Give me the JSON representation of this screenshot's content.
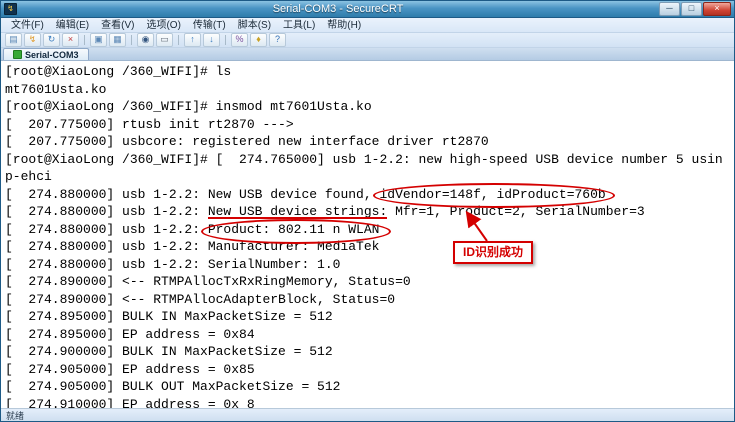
{
  "window": {
    "title": "Serial-COM3 - SecureCRT",
    "controls": {
      "minimize": "─",
      "maximize": "□",
      "close": "×"
    }
  },
  "menu": {
    "items": [
      "文件(F)",
      "编辑(E)",
      "查看(V)",
      "选项(O)",
      "传输(T)",
      "脚本(S)",
      "工具(L)",
      "帮助(H)"
    ]
  },
  "toolbar": {
    "items": [
      {
        "name": "session-manager-icon",
        "glyph": "▤",
        "color": "#5b87b5"
      },
      {
        "name": "quick-connect-icon",
        "glyph": "↯",
        "color": "#e09c2f"
      },
      {
        "name": "reconnect-icon",
        "glyph": "↻",
        "color": "#3f7fbf"
      },
      {
        "name": "disconnect-icon",
        "glyph": "×",
        "color": "#c23b3b"
      },
      {
        "name": "sep"
      },
      {
        "name": "copy-icon",
        "glyph": "▣",
        "color": "#5b87b5"
      },
      {
        "name": "paste-icon",
        "glyph": "▦",
        "color": "#5b87b5"
      },
      {
        "name": "sep"
      },
      {
        "name": "find-icon",
        "glyph": "◉",
        "color": "#33557f"
      },
      {
        "name": "print-icon",
        "glyph": "▭",
        "color": "#666f7a"
      },
      {
        "name": "sep"
      },
      {
        "name": "upload-icon",
        "glyph": "↑",
        "color": "#3f7fbf"
      },
      {
        "name": "download-icon",
        "glyph": "↓",
        "color": "#3f7fbf"
      },
      {
        "name": "sep"
      },
      {
        "name": "percent-icon",
        "glyph": "%",
        "color": "#7a4f9e"
      },
      {
        "name": "key-icon",
        "glyph": "♦",
        "color": "#c9a227"
      },
      {
        "name": "help-icon",
        "glyph": "?",
        "color": "#2f6db5"
      }
    ]
  },
  "tab": {
    "label": "Serial-COM3"
  },
  "terminal": {
    "lines": [
      "[root@XiaoLong /360_WIFI]# ls",
      "mt7601Usta.ko",
      "[root@XiaoLong /360_WIFI]# insmod mt7601Usta.ko",
      "[  207.775000] rtusb init rt2870 --->",
      "[  207.775000] usbcore: registered new interface driver rt2870",
      "[root@XiaoLong /360_WIFI]# [  274.765000] usb 1-2.2: new high-speed USB device number 5 usin",
      "p-ehci",
      "[  274.880000] usb 1-2.2: New USB device found, idVendor=148f, idProduct=760b",
      "[  274.880000] usb 1-2.2: New USB device strings: Mfr=1, Product=2, SerialNumber=3",
      "[  274.880000] usb 1-2.2: Product: 802.11 n WLAN",
      "[  274.880000] usb 1-2.2: Manufacturer: MediaTek",
      "[  274.880000] usb 1-2.2: SerialNumber: 1.0",
      "[  274.890000] <-- RTMPAllocTxRxRingMemory, Status=0",
      "[  274.890000] <-- RTMPAllocAdapterBlock, Status=0",
      "[  274.895000] BULK IN MaxPacketSize = 512",
      "[  274.895000] EP address = 0x84",
      "[  274.900000] BULK IN MaxPacketSize = 512",
      "[  274.905000] EP address = 0x85",
      "[  274.905000] BULK OUT MaxPacketSize = 512",
      "[  274.910000] EP address = 0x 8"
    ]
  },
  "annotations": {
    "callout": "ID识别成功",
    "circled_1": "idVendor=148f, idProduct=760b",
    "underlined": "New USB device strings:",
    "circled_2": "Product: 802.11 n WLAN"
  },
  "statusbar": {
    "left": "就绪"
  },
  "colors": {
    "annotation_red": "#d40000",
    "titlebar_blue": "#2e7cab",
    "tab_status_green": "#37a937",
    "chrome_bg": "#d9e7f7"
  }
}
